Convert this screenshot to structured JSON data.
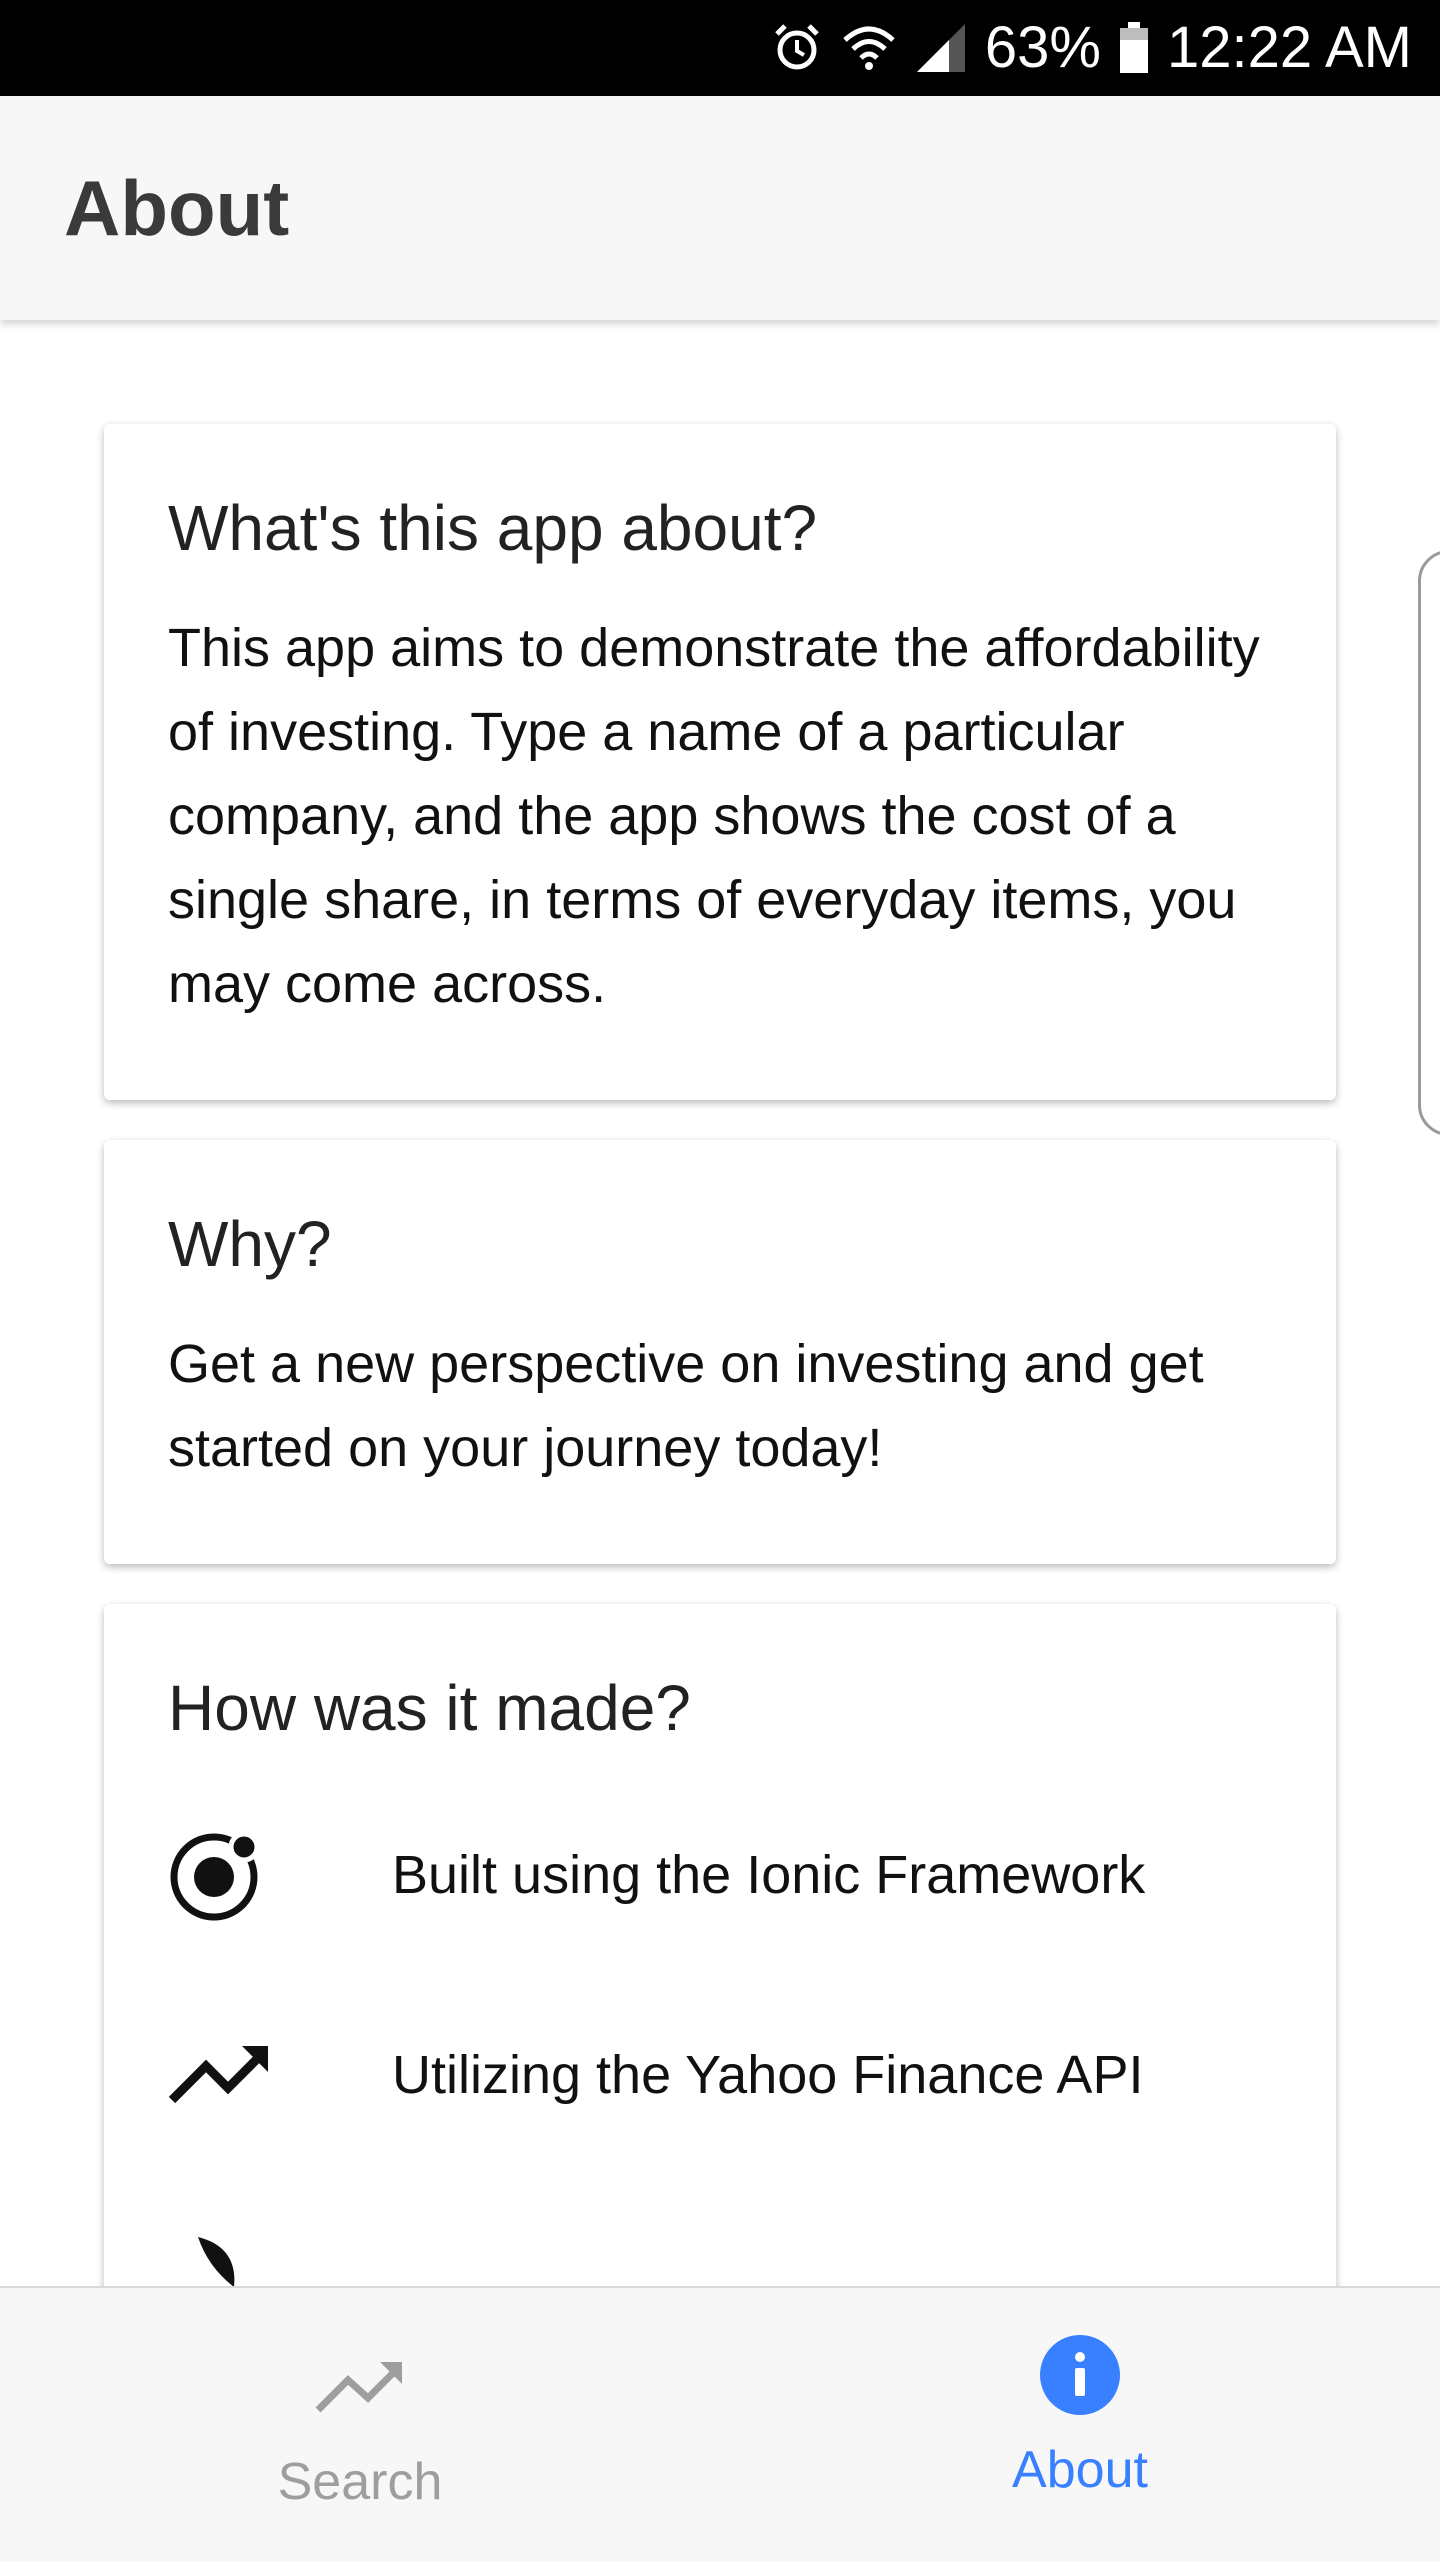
{
  "status_bar": {
    "battery_percent": "63%",
    "time": "12:22 AM",
    "icons": [
      "alarm-icon",
      "wifi-icon",
      "signal-icon",
      "battery-icon"
    ]
  },
  "header": {
    "title": "About"
  },
  "cards": {
    "about": {
      "title": "What's this app about?",
      "body": "This app aims to demonstrate the affordability of investing. Type a name of a particular company, and the app shows the cost of a single share, in terms of everyday items, you may come across."
    },
    "why": {
      "title": "Why?",
      "body": "Get a new perspective on investing and get started on your journey today!"
    },
    "how": {
      "title": "How was it made?",
      "items": [
        {
          "icon": "ionic-icon",
          "label": "Built using the Ionic Framework"
        },
        {
          "icon": "trending-up-icon",
          "label": "Utilizing the Yahoo Finance API"
        }
      ]
    }
  },
  "tabs": [
    {
      "label": "Search",
      "icon": "trending-up-icon",
      "active": false
    },
    {
      "label": "About",
      "icon": "info-icon",
      "active": true
    }
  ],
  "colors": {
    "accent": "#3880ff",
    "inactive": "#9e9e9e",
    "header_bg": "#f7f7f7"
  }
}
